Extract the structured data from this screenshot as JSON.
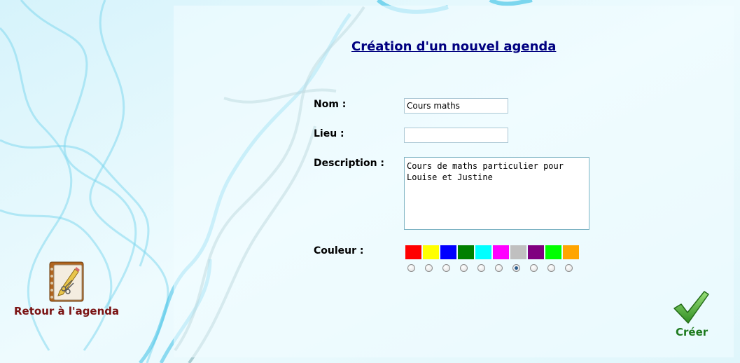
{
  "form": {
    "title": "Création d'un nouvel agenda",
    "name_label": "Nom :",
    "name_value": "Cours maths",
    "place_label": "Lieu :",
    "place_value": "",
    "description_label": "Description :",
    "description_value": "Cours de maths particulier pour Louise et Justine",
    "color_label": "Couleur :",
    "colors": [
      "#ff0000",
      "#ffff00",
      "#0000ff",
      "#008000",
      "#00ffff",
      "#ff00ff",
      "#c0c0c0",
      "#800080",
      "#00ff00",
      "#ffa500"
    ],
    "selected_color_index": 6
  },
  "actions": {
    "back_label": "Retour à l'agenda",
    "back_icon": "notebook-pencil-icon",
    "create_label": "Créer",
    "create_icon": "checkmark-icon"
  }
}
